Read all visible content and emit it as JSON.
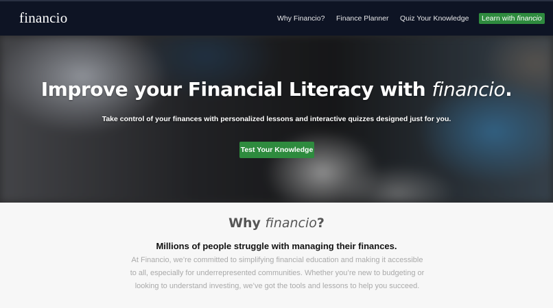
{
  "nav": {
    "brand": "financio",
    "links": [
      "Why Financio?",
      "Finance Planner",
      "Quiz Your Knowledge"
    ],
    "cta_prefix": "Learn with ",
    "cta_emphasis": "financio"
  },
  "hero": {
    "title_prefix": "Improve your Financial Literacy with ",
    "title_emphasis": "financio",
    "title_suffix": ".",
    "subtitle": "Take control of your finances with personalized lessons and interactive quizzes designed just for you.",
    "button_label": "Test Your Knowledge"
  },
  "why": {
    "title_prefix": "Why ",
    "title_emphasis": "financio",
    "title_suffix": "?",
    "lead": "Millions of people struggle with managing their finances.",
    "body": "At Financio, we’re committed to simplifying financial education and making it accessible to all, especially for underrepresented communities. Whether you’re new to budgeting or looking to understand investing, we’ve got the tools and lessons to help you succeed."
  },
  "colors": {
    "nav_background": "#0e1424",
    "accent_green": "#2e8b3e"
  }
}
